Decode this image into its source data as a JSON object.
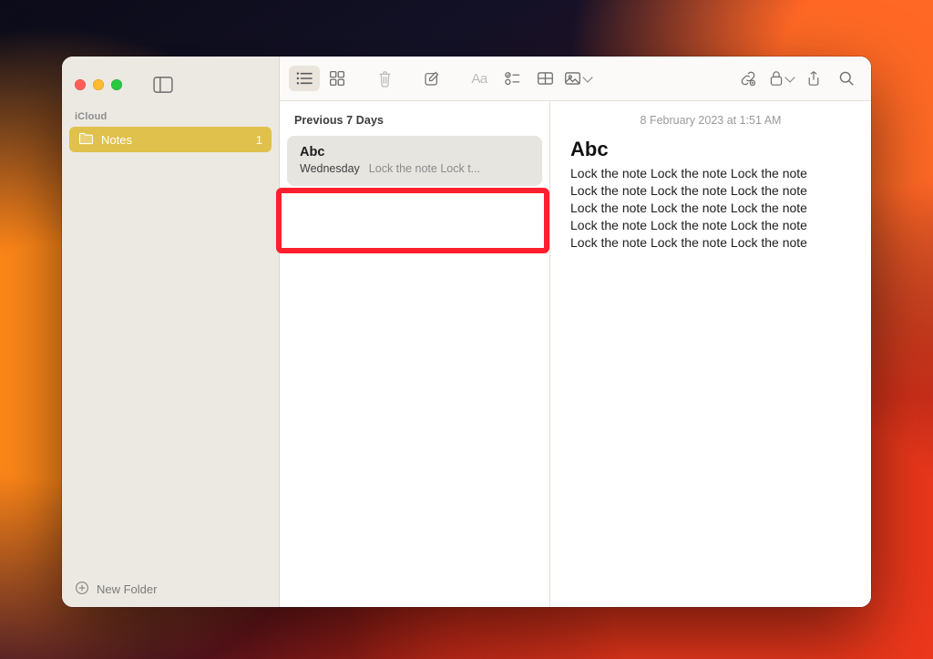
{
  "sidebar": {
    "section_label": "iCloud",
    "folder": {
      "name": "Notes",
      "count": "1"
    },
    "new_folder_label": "New Folder"
  },
  "notes_list": {
    "group_header": "Previous 7 Days",
    "items": [
      {
        "title": "Abc",
        "date": "Wednesday",
        "preview": "Lock the note Lock t..."
      }
    ]
  },
  "editor": {
    "timestamp": "8 February 2023 at 1:51 AM",
    "title": "Abc",
    "body": "Lock the note Lock the note Lock the note\nLock the note Lock the note Lock the note\nLock the note Lock the note Lock the note\nLock the note Lock the note Lock the note\nLock the note Lock the note Lock the note"
  }
}
